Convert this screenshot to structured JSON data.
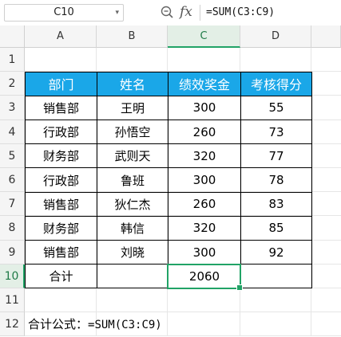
{
  "formula_bar": {
    "cell_ref": "C10",
    "formula": "=SUM(C3:C9)",
    "fx_label": "fx"
  },
  "columns": [
    "A",
    "B",
    "C",
    "D"
  ],
  "rows": [
    "1",
    "2",
    "3",
    "4",
    "5",
    "6",
    "7",
    "8",
    "9",
    "10",
    "11",
    "12"
  ],
  "active_cell": {
    "column": "C",
    "row": "10"
  },
  "table": {
    "headers": [
      "部门",
      "姓名",
      "绩效奖金",
      "考核得分"
    ],
    "rows": [
      [
        "销售部",
        "王明",
        "300",
        "55"
      ],
      [
        "行政部",
        "孙悟空",
        "260",
        "73"
      ],
      [
        "财务部",
        "武则天",
        "320",
        "77"
      ],
      [
        "行政部",
        "鲁班",
        "300",
        "78"
      ],
      [
        "销售部",
        "狄仁杰",
        "260",
        "83"
      ],
      [
        "财务部",
        "韩信",
        "320",
        "85"
      ],
      [
        "销售部",
        "刘晓",
        "300",
        "92"
      ]
    ],
    "total_row": [
      "合计",
      "",
      "2060",
      ""
    ]
  },
  "note": {
    "label": "合计公式：",
    "formula": "=SUM(C3:C9)"
  },
  "colors": {
    "header_fill": "#1aa7e8",
    "selection": "#21a366"
  }
}
